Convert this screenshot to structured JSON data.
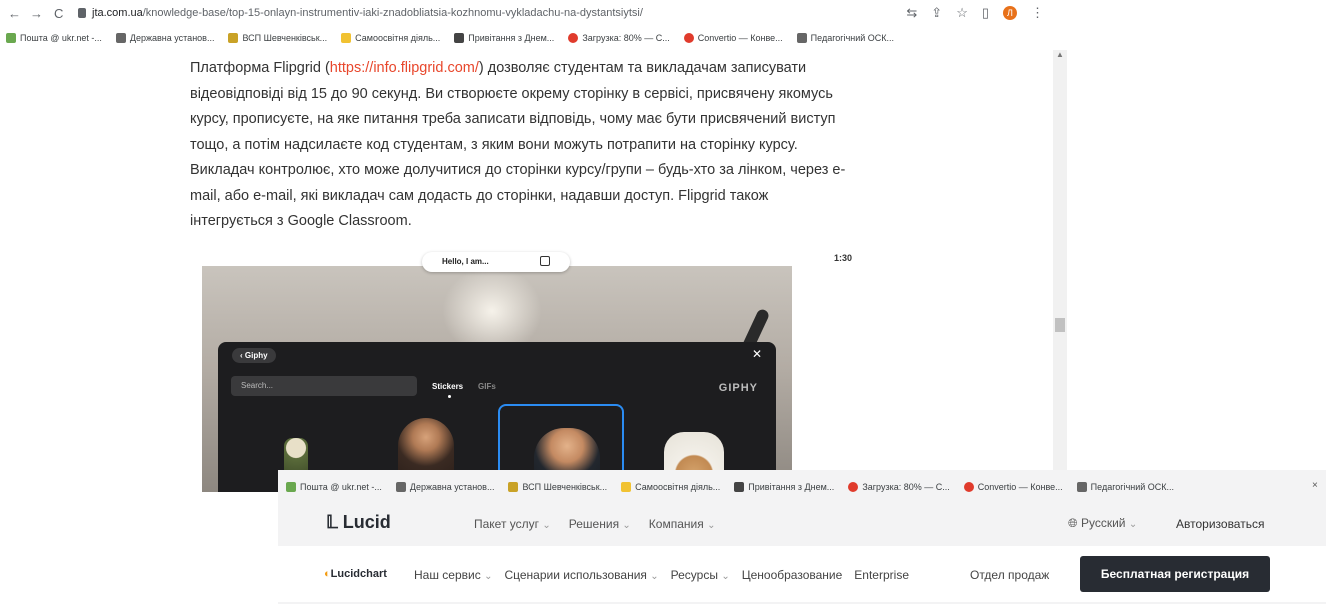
{
  "browser": {
    "url_host": "jta.com.ua",
    "url_path": "/knowledge-base/top-15-onlayn-instrumentiv-iaki-znadobliatsia-kozhnomu-vykladachu-na-dystantsiytsi/",
    "avatar_letter": "Л"
  },
  "bookmarks": [
    {
      "label": "Пошта @ ukr.net -...",
      "color": "#6aa84f"
    },
    {
      "label": "Державна установ...",
      "color": "#666666"
    },
    {
      "label": "ВСП Шевченківськ...",
      "color": "#c9a227"
    },
    {
      "label": "Самоосвітня діяль...",
      "color": "#f1c232"
    },
    {
      "label": "Привітання з Днем...",
      "color": "#444444"
    },
    {
      "label": "Загрузка: 80% — С...",
      "color": "#e03b2c"
    },
    {
      "label": "Convertio — Конве...",
      "color": "#e03b2c"
    },
    {
      "label": "Педагогічний ОСК...",
      "color": "#666666"
    }
  ],
  "bookmarks2": [
    {
      "label": "Пошта @ ukr.net -...",
      "color": "#6aa84f"
    },
    {
      "label": "Державна установ...",
      "color": "#666666"
    },
    {
      "label": "ВСП Шевченківськ...",
      "color": "#c9a227"
    },
    {
      "label": "Самоосвітня діяль...",
      "color": "#f1c232"
    },
    {
      "label": "Привітання з Днем...",
      "color": "#444444"
    },
    {
      "label": "Загрузка: 80% — С...",
      "color": "#e03b2c"
    },
    {
      "label": "Convertio — Конве...",
      "color": "#e03b2c"
    },
    {
      "label": "Педагогічний ОСК...",
      "color": "#666666"
    }
  ],
  "article": {
    "before_link": "Платформа Flipgrid (",
    "link": "https://info.flipgrid.com/",
    "after_link": ") дозволяє студентам та викладачам записувати відеовідповіді від 15 до 90 секунд. Ви створюєте окрему сторінку в сервісі, присвячену якомусь курсу, прописуєте, на яке питання треба записати відповідь, чому має бути присвячений виступ тощо, а потім надсилаєте код студентам, з яким вони можуть потрапити на сторінку курсу. Викладач контролює, хто може долучитися до сторінки курсу/групи – будь-хто за лінком, через e-mail, або e-mail, які викладач сам додасть до сторінки, надавши доступ. Flipgrid також інтегрується з Google Classroom."
  },
  "video": {
    "pill_label": "Hello, I am...",
    "timer": "1:30",
    "giphy_back": "Giphy",
    "search_placeholder": "Search...",
    "tab_stickers": "Stickers",
    "tab_gifs": "GIFs",
    "brand": "GIPHY"
  },
  "lucid": {
    "logo": "Lucid",
    "nav": [
      "Пакет услуг",
      "Решения",
      "Компания"
    ],
    "language": "Русский",
    "login": "Авторизоваться",
    "product": "Lucidchart",
    "nav2": [
      "Наш сервис",
      "Сценарии использования",
      "Ресурсы",
      "Ценообразование",
      "Enterprise"
    ],
    "sales": "Отдел продаж",
    "cta": "Бесплатная регистрация"
  }
}
